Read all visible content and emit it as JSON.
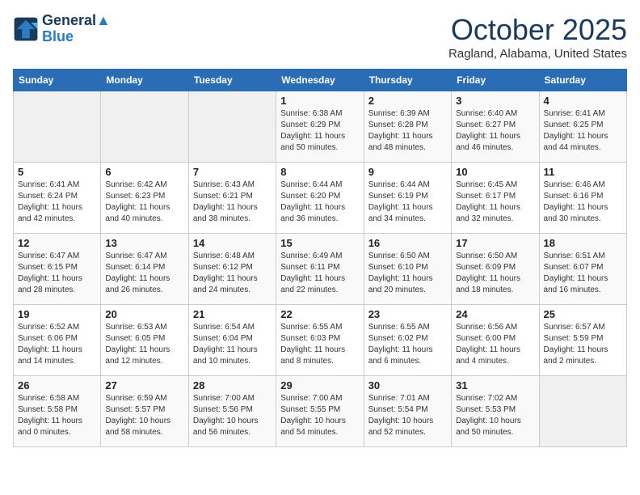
{
  "header": {
    "logo_line1": "General",
    "logo_line2": "Blue",
    "month": "October 2025",
    "location": "Ragland, Alabama, United States"
  },
  "weekdays": [
    "Sunday",
    "Monday",
    "Tuesday",
    "Wednesday",
    "Thursday",
    "Friday",
    "Saturday"
  ],
  "weeks": [
    [
      {
        "day": "",
        "info": ""
      },
      {
        "day": "",
        "info": ""
      },
      {
        "day": "",
        "info": ""
      },
      {
        "day": "1",
        "info": "Sunrise: 6:38 AM\nSunset: 6:29 PM\nDaylight: 11 hours\nand 50 minutes."
      },
      {
        "day": "2",
        "info": "Sunrise: 6:39 AM\nSunset: 6:28 PM\nDaylight: 11 hours\nand 48 minutes."
      },
      {
        "day": "3",
        "info": "Sunrise: 6:40 AM\nSunset: 6:27 PM\nDaylight: 11 hours\nand 46 minutes."
      },
      {
        "day": "4",
        "info": "Sunrise: 6:41 AM\nSunset: 6:25 PM\nDaylight: 11 hours\nand 44 minutes."
      }
    ],
    [
      {
        "day": "5",
        "info": "Sunrise: 6:41 AM\nSunset: 6:24 PM\nDaylight: 11 hours\nand 42 minutes."
      },
      {
        "day": "6",
        "info": "Sunrise: 6:42 AM\nSunset: 6:23 PM\nDaylight: 11 hours\nand 40 minutes."
      },
      {
        "day": "7",
        "info": "Sunrise: 6:43 AM\nSunset: 6:21 PM\nDaylight: 11 hours\nand 38 minutes."
      },
      {
        "day": "8",
        "info": "Sunrise: 6:44 AM\nSunset: 6:20 PM\nDaylight: 11 hours\nand 36 minutes."
      },
      {
        "day": "9",
        "info": "Sunrise: 6:44 AM\nSunset: 6:19 PM\nDaylight: 11 hours\nand 34 minutes."
      },
      {
        "day": "10",
        "info": "Sunrise: 6:45 AM\nSunset: 6:17 PM\nDaylight: 11 hours\nand 32 minutes."
      },
      {
        "day": "11",
        "info": "Sunrise: 6:46 AM\nSunset: 6:16 PM\nDaylight: 11 hours\nand 30 minutes."
      }
    ],
    [
      {
        "day": "12",
        "info": "Sunrise: 6:47 AM\nSunset: 6:15 PM\nDaylight: 11 hours\nand 28 minutes."
      },
      {
        "day": "13",
        "info": "Sunrise: 6:47 AM\nSunset: 6:14 PM\nDaylight: 11 hours\nand 26 minutes."
      },
      {
        "day": "14",
        "info": "Sunrise: 6:48 AM\nSunset: 6:12 PM\nDaylight: 11 hours\nand 24 minutes."
      },
      {
        "day": "15",
        "info": "Sunrise: 6:49 AM\nSunset: 6:11 PM\nDaylight: 11 hours\nand 22 minutes."
      },
      {
        "day": "16",
        "info": "Sunrise: 6:50 AM\nSunset: 6:10 PM\nDaylight: 11 hours\nand 20 minutes."
      },
      {
        "day": "17",
        "info": "Sunrise: 6:50 AM\nSunset: 6:09 PM\nDaylight: 11 hours\nand 18 minutes."
      },
      {
        "day": "18",
        "info": "Sunrise: 6:51 AM\nSunset: 6:07 PM\nDaylight: 11 hours\nand 16 minutes."
      }
    ],
    [
      {
        "day": "19",
        "info": "Sunrise: 6:52 AM\nSunset: 6:06 PM\nDaylight: 11 hours\nand 14 minutes."
      },
      {
        "day": "20",
        "info": "Sunrise: 6:53 AM\nSunset: 6:05 PM\nDaylight: 11 hours\nand 12 minutes."
      },
      {
        "day": "21",
        "info": "Sunrise: 6:54 AM\nSunset: 6:04 PM\nDaylight: 11 hours\nand 10 minutes."
      },
      {
        "day": "22",
        "info": "Sunrise: 6:55 AM\nSunset: 6:03 PM\nDaylight: 11 hours\nand 8 minutes."
      },
      {
        "day": "23",
        "info": "Sunrise: 6:55 AM\nSunset: 6:02 PM\nDaylight: 11 hours\nand 6 minutes."
      },
      {
        "day": "24",
        "info": "Sunrise: 6:56 AM\nSunset: 6:00 PM\nDaylight: 11 hours\nand 4 minutes."
      },
      {
        "day": "25",
        "info": "Sunrise: 6:57 AM\nSunset: 5:59 PM\nDaylight: 11 hours\nand 2 minutes."
      }
    ],
    [
      {
        "day": "26",
        "info": "Sunrise: 6:58 AM\nSunset: 5:58 PM\nDaylight: 11 hours\nand 0 minutes."
      },
      {
        "day": "27",
        "info": "Sunrise: 6:59 AM\nSunset: 5:57 PM\nDaylight: 10 hours\nand 58 minutes."
      },
      {
        "day": "28",
        "info": "Sunrise: 7:00 AM\nSunset: 5:56 PM\nDaylight: 10 hours\nand 56 minutes."
      },
      {
        "day": "29",
        "info": "Sunrise: 7:00 AM\nSunset: 5:55 PM\nDaylight: 10 hours\nand 54 minutes."
      },
      {
        "day": "30",
        "info": "Sunrise: 7:01 AM\nSunset: 5:54 PM\nDaylight: 10 hours\nand 52 minutes."
      },
      {
        "day": "31",
        "info": "Sunrise: 7:02 AM\nSunset: 5:53 PM\nDaylight: 10 hours\nand 50 minutes."
      },
      {
        "day": "",
        "info": ""
      }
    ]
  ]
}
